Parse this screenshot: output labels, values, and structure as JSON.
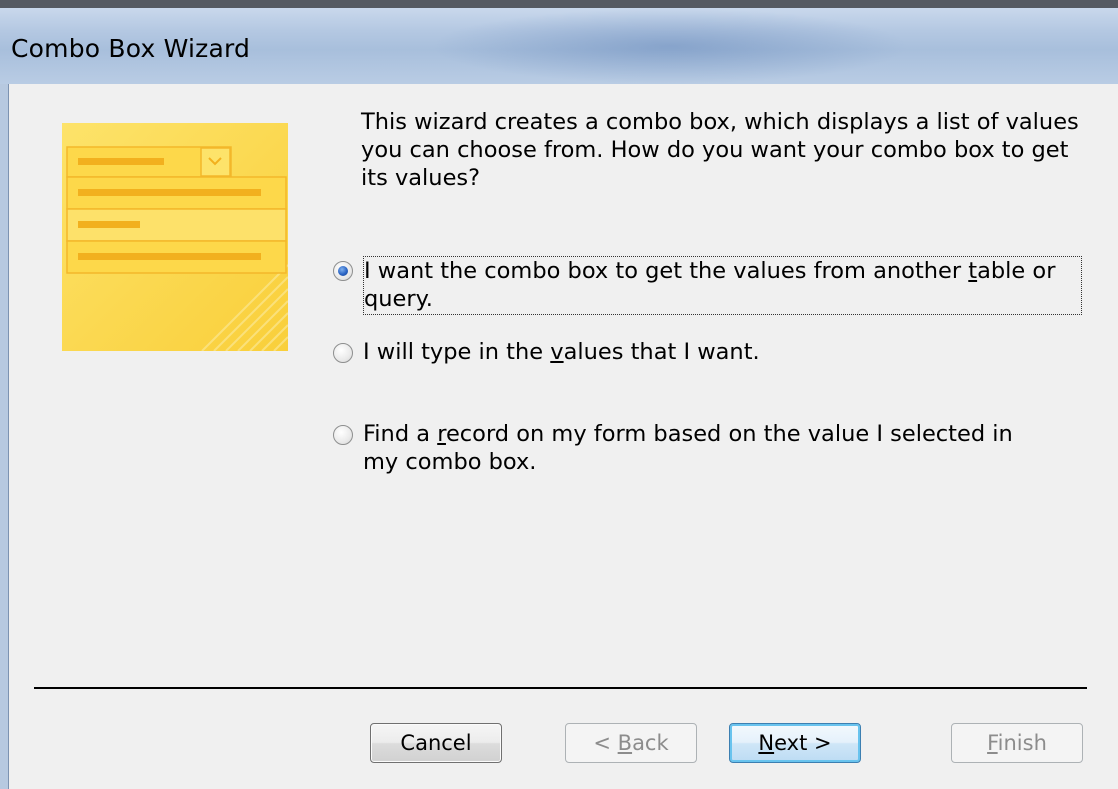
{
  "window": {
    "title": "Combo Box Wizard"
  },
  "intro_text": "This wizard creates a combo box, which displays a list of values you can choose from.  How do you want your combo box to get its values?",
  "options": [
    {
      "label_pre": "I want the combo box to get the values from another ",
      "label_key": "t",
      "label_post": "able or query.",
      "selected": true
    },
    {
      "label_pre": "I will type in the ",
      "label_key": "v",
      "label_post": "alues that I want.",
      "selected": false
    },
    {
      "label_pre": "Find a ",
      "label_key": "r",
      "label_post": "ecord on my form based on the value I selected in my combo box.",
      "selected": false
    }
  ],
  "buttons": {
    "cancel": {
      "label": "Cancel",
      "enabled": true
    },
    "back": {
      "label_pre": "< ",
      "label_key": "B",
      "label_post": "ack",
      "enabled": false
    },
    "next": {
      "label_key": "N",
      "label_post": "ext >",
      "enabled": true,
      "default": true
    },
    "finish": {
      "label_key": "F",
      "label_post": "inish",
      "enabled": false
    }
  },
  "colors": {
    "illustration_bg": "#fbd94a",
    "illustration_accent": "#f5b522",
    "radio_selected": "#2a64c4"
  },
  "icons": {
    "illustration": "combo-box-wizard-illustration",
    "dropdown": "chevron-down-icon"
  }
}
